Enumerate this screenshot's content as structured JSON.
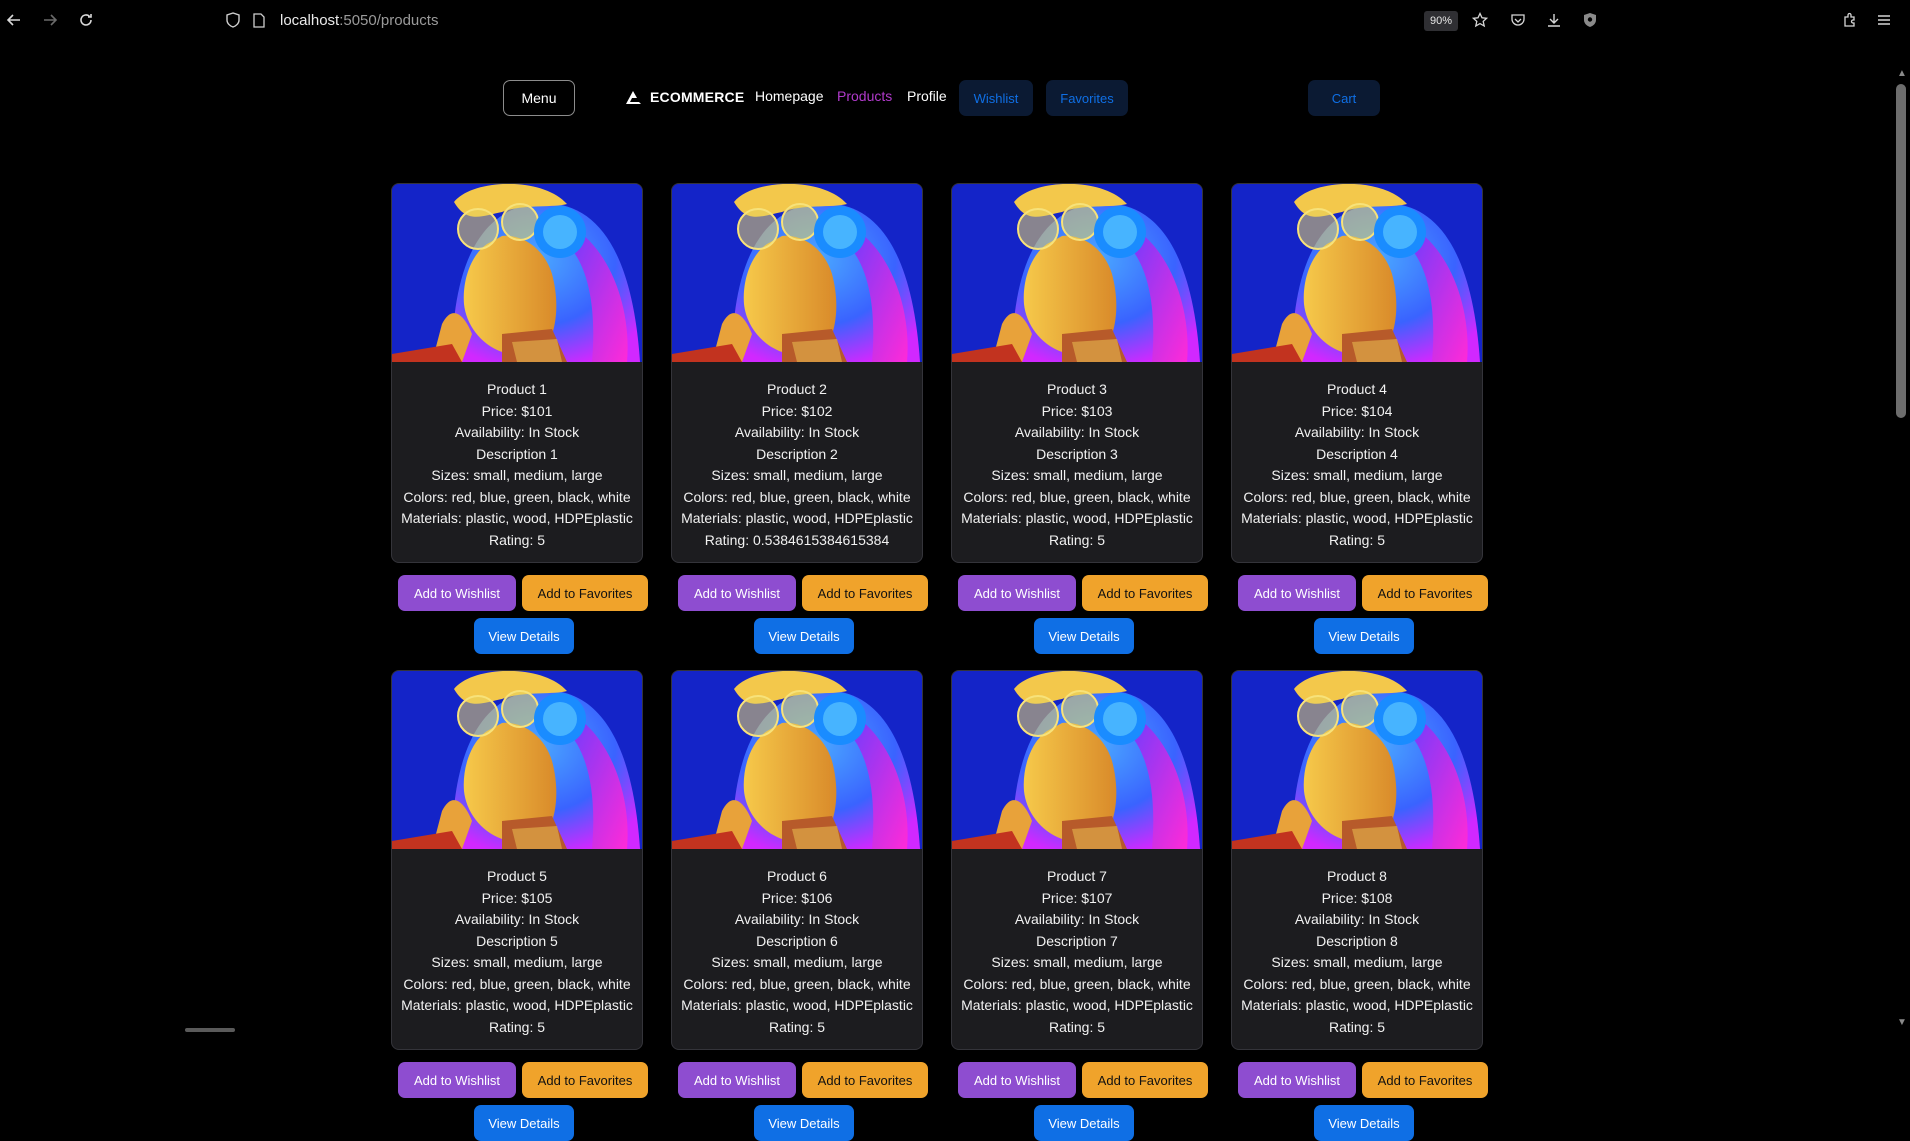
{
  "browser": {
    "url_host": "localhost",
    "url_path": ":5050/products",
    "zoom": "90%"
  },
  "nav": {
    "menu_label": "Menu",
    "brand": "ECOMMERCE",
    "links": [
      "Homepage",
      "Products",
      "Profile"
    ],
    "active_link": "Products",
    "wishlist_label": "Wishlist",
    "favorites_label": "Favorites",
    "cart_label": "Cart"
  },
  "actions": {
    "wishlist": "Add to Wishlist",
    "favorites": "Add to Favorites",
    "details": "View Details"
  },
  "colors": {
    "active_link": "#b03aca",
    "wishlist_button": "#8e4dd0",
    "favorites_button": "#f0a32b",
    "details_button": "#0f6fe5",
    "card_background": "#1c1c1f"
  },
  "products": [
    {
      "name": "Product 1",
      "price": "Price: $101",
      "availability": "Availability: In Stock",
      "description": "Description 1",
      "sizes": "Sizes: small, medium, large",
      "colors": "Colors: red, blue, green, black, white",
      "materials": "Materials: plastic, wood, HDPEplastic",
      "rating": "Rating: 5"
    },
    {
      "name": "Product 2",
      "price": "Price: $102",
      "availability": "Availability: In Stock",
      "description": "Description 2",
      "sizes": "Sizes: small, medium, large",
      "colors": "Colors: red, blue, green, black, white",
      "materials": "Materials: plastic, wood, HDPEplastic",
      "rating": "Rating: 0.5384615384615384"
    },
    {
      "name": "Product 3",
      "price": "Price: $103",
      "availability": "Availability: In Stock",
      "description": "Description 3",
      "sizes": "Sizes: small, medium, large",
      "colors": "Colors: red, blue, green, black, white",
      "materials": "Materials: plastic, wood, HDPEplastic",
      "rating": "Rating: 5"
    },
    {
      "name": "Product 4",
      "price": "Price: $104",
      "availability": "Availability: In Stock",
      "description": "Description 4",
      "sizes": "Sizes: small, medium, large",
      "colors": "Colors: red, blue, green, black, white",
      "materials": "Materials: plastic, wood, HDPEplastic",
      "rating": "Rating: 5"
    },
    {
      "name": "Product 5",
      "price": "Price: $105",
      "availability": "Availability: In Stock",
      "description": "Description 5",
      "sizes": "Sizes: small, medium, large",
      "colors": "Colors: red, blue, green, black, white",
      "materials": "Materials: plastic, wood, HDPEplastic",
      "rating": "Rating: 5"
    },
    {
      "name": "Product 6",
      "price": "Price: $106",
      "availability": "Availability: In Stock",
      "description": "Description 6",
      "sizes": "Sizes: small, medium, large",
      "colors": "Colors: red, blue, green, black, white",
      "materials": "Materials: plastic, wood, HDPEplastic",
      "rating": "Rating: 5"
    },
    {
      "name": "Product 7",
      "price": "Price: $107",
      "availability": "Availability: In Stock",
      "description": "Description 7",
      "sizes": "Sizes: small, medium, large",
      "colors": "Colors: red, blue, green, black, white",
      "materials": "Materials: plastic, wood, HDPEplastic",
      "rating": "Rating: 5"
    },
    {
      "name": "Product 8",
      "price": "Price: $108",
      "availability": "Availability: In Stock",
      "description": "Description 8",
      "sizes": "Sizes: small, medium, large",
      "colors": "Colors: red, blue, green, black, white",
      "materials": "Materials: plastic, wood, HDPEplastic",
      "rating": "Rating: 5"
    }
  ]
}
